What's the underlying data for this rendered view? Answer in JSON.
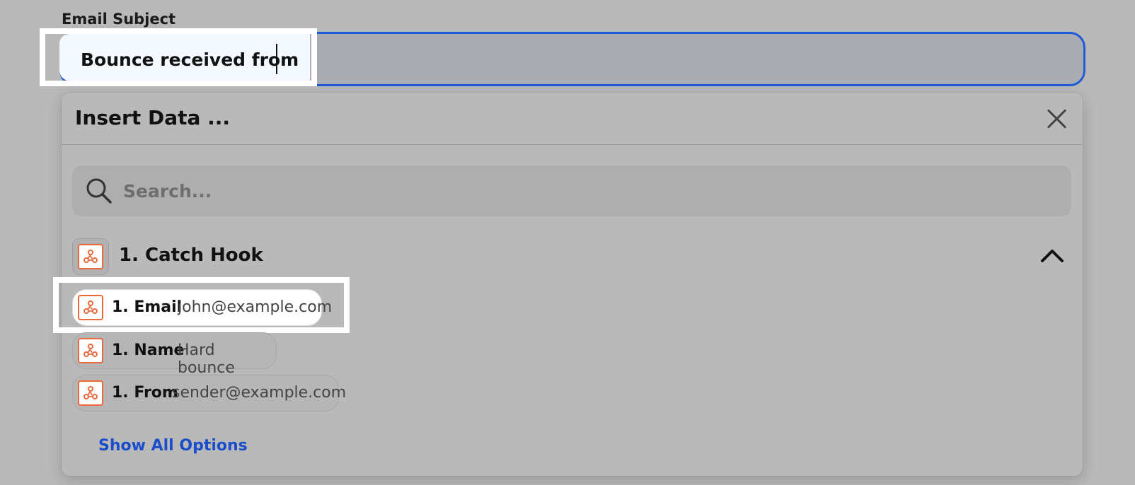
{
  "field": {
    "label": "Email Subject",
    "value": "Bounce received from "
  },
  "panel": {
    "title": "Insert Data ...",
    "search_placeholder": "Search..."
  },
  "group": {
    "title": "1. Catch Hook"
  },
  "items": [
    {
      "key": "1. Email",
      "value": "john@example.com",
      "selected": true
    },
    {
      "key": "1. Name",
      "value": "Hard bounce",
      "selected": false
    },
    {
      "key": "1. From",
      "value": "sender@example.com",
      "selected": false
    }
  ],
  "footer": {
    "show_all_label": "Show All Options"
  },
  "colors": {
    "accent": "#1e5bd6",
    "webhook_orange": "#ea6a3d",
    "link_blue": "#1b4fc9"
  },
  "icons": [
    "search-icon",
    "close-icon",
    "webhook-icon",
    "chevron-up-icon"
  ]
}
